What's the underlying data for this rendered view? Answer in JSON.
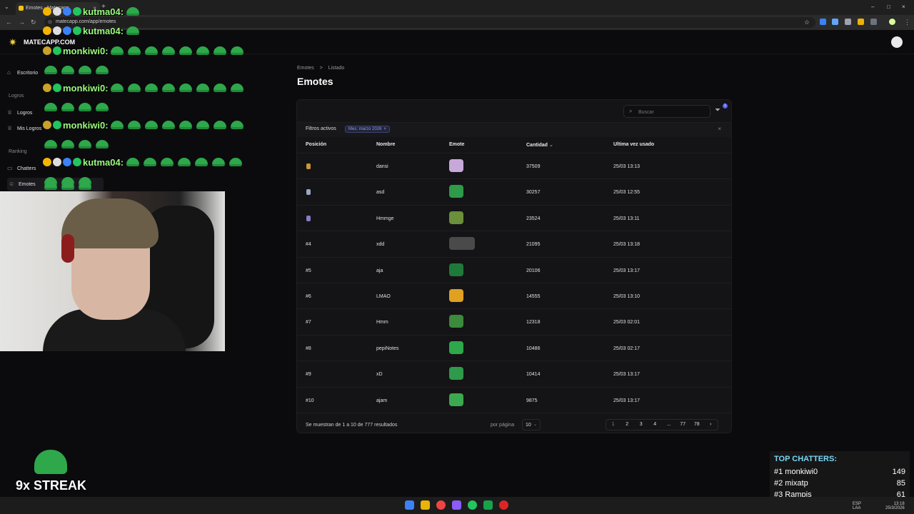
{
  "browser": {
    "tab_title": "Emotes - Matecapp",
    "tab_close": "×",
    "new_tab": "+",
    "url": "matecapp.com/app/emotes",
    "window_controls": [
      "–",
      "□",
      "×"
    ]
  },
  "app": {
    "logo": "MATECAPP.COM",
    "breadcrumb": [
      "Emotes",
      ">",
      "Listado"
    ],
    "title": "Emotes"
  },
  "sidebar": {
    "items": [
      {
        "label": "Escritorio",
        "icon": "home-icon"
      },
      {
        "label": "Logros",
        "icon": "trophy-icon"
      },
      {
        "label": "Mis Logros",
        "icon": "trophy-icon"
      },
      {
        "label": "Chatters",
        "icon": "chat-icon"
      },
      {
        "label": "Emotes",
        "icon": "smile-icon"
      }
    ],
    "sections": [
      "Logros",
      "Ranking"
    ]
  },
  "search": {
    "placeholder": "Buscar",
    "filter_count": "1"
  },
  "filters": {
    "label": "Filtros activos",
    "chip": "Mes: marzo 2026",
    "chip_close": "×",
    "close": "×"
  },
  "table": {
    "headers": [
      "Posición",
      "Nombre",
      "Emote",
      "Cantidad",
      "Ultima vez usado"
    ],
    "sort_indicator": "⌄",
    "rows": [
      {
        "pos": "",
        "medal": "gold",
        "name": "dansi",
        "qty": "37509",
        "last": "25/03 13:13"
      },
      {
        "pos": "",
        "medal": "silver",
        "name": "asd",
        "qty": "30257",
        "last": "25/03 12:55"
      },
      {
        "pos": "",
        "medal": "bronze",
        "name": "Hmmge",
        "qty": "23524",
        "last": "25/03 13:11"
      },
      {
        "pos": "#4",
        "name": "xdd",
        "qty": "21095",
        "last": "25/03 13:18"
      },
      {
        "pos": "#5",
        "name": "aja",
        "qty": "20106",
        "last": "25/03 13:17"
      },
      {
        "pos": "#6",
        "name": "LMAO",
        "qty": "14555",
        "last": "25/03 13:10"
      },
      {
        "pos": "#7",
        "name": "Hmm",
        "qty": "12318",
        "last": "25/03 02:01"
      },
      {
        "pos": "#8",
        "name": "pepiNotes",
        "qty": "10486",
        "last": "25/03 02:17"
      },
      {
        "pos": "#9",
        "name": "xD",
        "qty": "10414",
        "last": "25/03 13:17"
      },
      {
        "pos": "#10",
        "name": "ajam",
        "qty": "9875",
        "last": "25/03 13:17"
      }
    ]
  },
  "footer": {
    "results": "Se muestran de 1 a 10 de 777 resultados",
    "per_page_label": "por página",
    "per_page": "10",
    "pages": [
      "1",
      "2",
      "3",
      "4",
      "...",
      "77",
      "78",
      "›"
    ]
  },
  "chat": [
    {
      "user": "kutma04:",
      "frogs_inline": 1,
      "frogs_next": 0
    },
    {
      "user": "kutma04:",
      "frogs_inline": 1,
      "frogs_next": 0
    },
    {
      "user": "monkiwi0:",
      "frogs_inline": 8,
      "frogs_next": 4
    },
    {
      "user": "monkiwi0:",
      "frogs_inline": 8,
      "frogs_next": 4
    },
    {
      "user": "monkiwi0:",
      "frogs_inline": 8,
      "frogs_next": 4
    },
    {
      "user": "kutma04:",
      "frogs_inline": 7,
      "frogs_next": 3
    }
  ],
  "streak": "9x STREAK",
  "top_chatters": {
    "title": "TOP CHATTERS:",
    "rows": [
      {
        "rank": "#1 monkiwi0",
        "count": "149"
      },
      {
        "rank": "#2 mixatp",
        "count": "85"
      },
      {
        "rank": "#3 Rampis",
        "count": "61"
      }
    ]
  },
  "tray": {
    "lang": "ESP",
    "lang2": "LAA",
    "time": "13:18",
    "date": "25/3/2026"
  }
}
